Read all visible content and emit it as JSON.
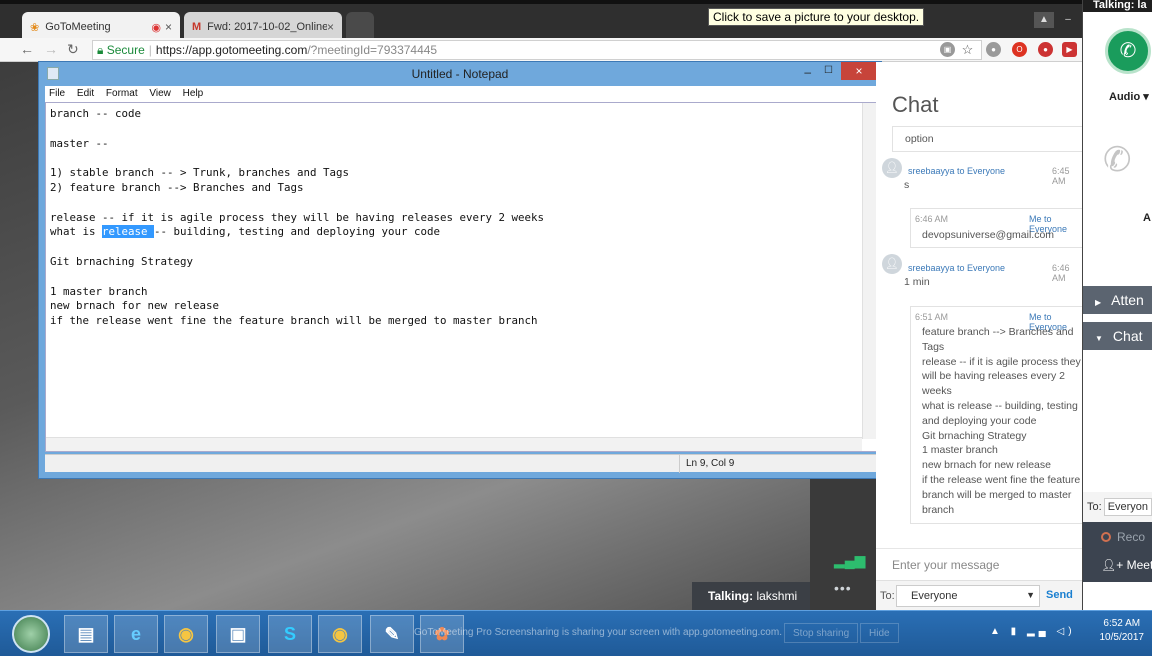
{
  "browser": {
    "tabs": [
      {
        "label": "GoToMeeting"
      },
      {
        "label": "Fwd: 2017-10-02_Online"
      }
    ],
    "address": {
      "secure": "Secure",
      "host": "https://app.gotomeeting.com",
      "path": "/?meetingId=793374445"
    },
    "tooltip": "Click to save a picture to your desktop."
  },
  "notepad": {
    "title": "Untitled - Notepad",
    "menu": [
      "File",
      "Edit",
      "Format",
      "View",
      "Help"
    ],
    "lines": {
      "l1": "branch -- code",
      "l2": "master --",
      "l3": "1) stable branch -- > Trunk, branches and Tags",
      "l4": "2) feature branch --> Branches and Tags",
      "l5": "release -- if it is agile process they will be having releases every 2 weeks",
      "l6a": "what is ",
      "l6sel": "release ",
      "l6b": "-- building, testing and deploying your code",
      "l7": "Git brnaching Strategy",
      "l8": "1 master branch",
      "l9": "new brnach for new release",
      "l10": "if the release went fine the feature branch will be merged to master branch"
    },
    "status": "Ln 9, Col 9"
  },
  "chat": {
    "title": "Chat",
    "option_text": "option",
    "msg1": {
      "sender": "sreebaayya to Everyone",
      "time": "6:45 AM",
      "text": "s"
    },
    "msg2": {
      "time": "6:46 AM",
      "sender": "Me to Everyone",
      "text": "devopsuniverse@gmail.com"
    },
    "msg3": {
      "sender": "sreebaayya to Everyone",
      "time": "6:46 AM",
      "text": "1 min"
    },
    "msg4": {
      "time": "6:51 AM",
      "sender": "Me to Everyone",
      "lines": [
        "feature branch --> Branches and",
        "Tags",
        "release -- if it is agile process they",
        "will be having releases every 2",
        "weeks",
        "what is release -- building, testing",
        "and deploying your code",
        "Git brnaching Strategy",
        "1 master branch",
        "new brnach for new release",
        "if the release went fine the feature",
        "branch will be merged to master",
        "branch"
      ]
    },
    "input_placeholder": "Enter your message",
    "to_label": "To:",
    "to_value": "Everyone",
    "send_label": "Send"
  },
  "sidebar": {
    "talking_header": "Talking: la",
    "audio_label": "Audio",
    "a_label": "A",
    "sections": [
      "Atten",
      "Chat"
    ],
    "to_label": "To:",
    "to_value": "Everyon",
    "record_label": "Reco",
    "meet_label": "Meet"
  },
  "talking_bar": {
    "prefix": "Talking:",
    "name": "lakshmi"
  },
  "taskbar": {
    "share_note": "GoToMeeting Pro Screensharing is sharing your screen with app.gotomeeting.com.",
    "stop_sharing": "Stop sharing",
    "hide": "Hide",
    "time": "6:52 AM",
    "date": "10/5/2017"
  }
}
